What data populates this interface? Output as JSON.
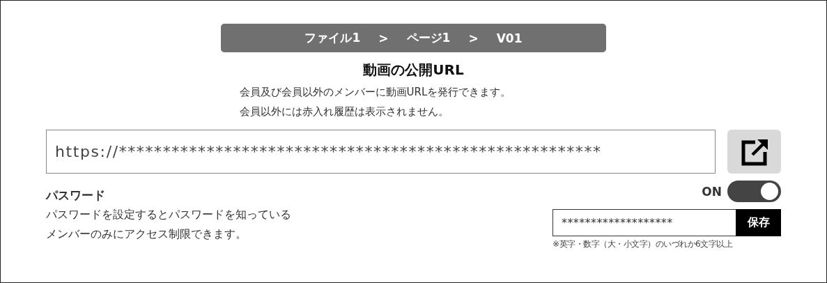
{
  "breadcrumb": [
    "ファイル1",
    ">",
    "ページ1",
    ">",
    "V01"
  ],
  "title": "動画の公開URL",
  "description": [
    "会員及び会員以外のメンバーに動画URLを発行できます。",
    "会員以外には赤入れ履歴は表示されません。"
  ],
  "url_field": {
    "value": "https://*******************************************************"
  },
  "password": {
    "label": "パスワード",
    "description": [
      "パスワードを設定するとパスワードを知っている",
      "メンバーのみにアクセス制限できます。"
    ],
    "toggle_label": "ON",
    "on": true,
    "value": "*******************",
    "save_button": "保存",
    "note": "※英字・数字（大・小文字）のいづれか6文字以上"
  }
}
